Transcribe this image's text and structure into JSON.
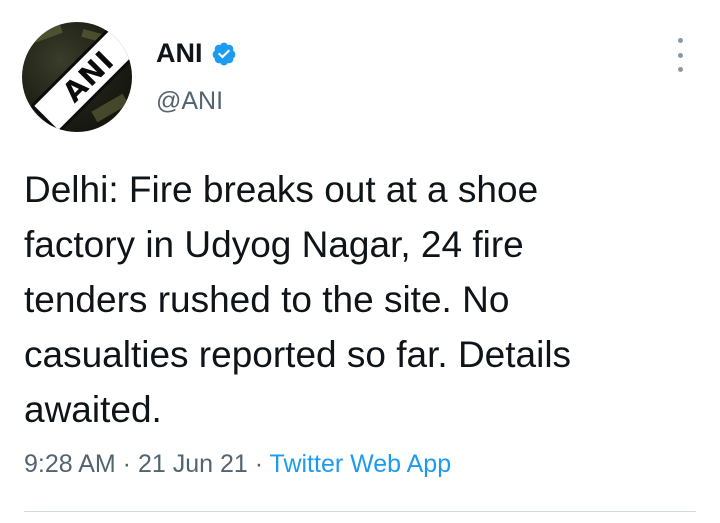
{
  "author": {
    "display_name": "ANI",
    "handle": "@ANI",
    "avatar_text": "ANI",
    "verified": true
  },
  "tweet": {
    "text": "Delhi: Fire breaks out at a shoe\nfactory in Udyog Nagar, 24 fire\ntenders rushed to the site. No\ncasualties reported so far. Details\nawaited."
  },
  "meta": {
    "time": "9:28 AM",
    "separator_1": " · ",
    "date": "21 Jun 21",
    "separator_2": " · ",
    "source": "Twitter Web App"
  },
  "colors": {
    "text": "#0f1419",
    "secondary": "#536471",
    "link": "#1d9bf0",
    "verified": "#1d9bf0"
  },
  "icons": {
    "verified": "verified-badge-icon",
    "more": "more-vertical-icon"
  }
}
